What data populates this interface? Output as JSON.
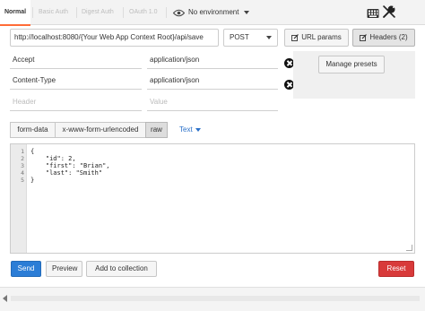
{
  "tabs": [
    {
      "label": "Normal",
      "active": true
    },
    {
      "label": "Basic Auth",
      "active": false
    },
    {
      "label": "Digest Auth",
      "active": false
    },
    {
      "label": "OAuth 1.0",
      "active": false
    }
  ],
  "environment": {
    "label": "No environment",
    "icon": "eye-icon"
  },
  "toolbar_icons": [
    "keyboard-icon",
    "wrench-icon"
  ],
  "request": {
    "url": "http://localhost:8080/{Your Web App Context Root}/api/save",
    "method": "POST",
    "url_params_label": "URL params",
    "headers_label": "Headers (2)"
  },
  "headers": [
    {
      "key": "Accept",
      "value": "application/json"
    },
    {
      "key": "Content-Type",
      "value": "application/json"
    }
  ],
  "header_placeholders": {
    "key": "Header",
    "value": "Value"
  },
  "manage_presets_label": "Manage presets",
  "body_modes": [
    {
      "label": "form-data",
      "active": false
    },
    {
      "label": "x-www-form-urlencoded",
      "active": false
    },
    {
      "label": "raw",
      "active": true
    }
  ],
  "raw_format": "Text",
  "editor": {
    "line_numbers": [
      "1",
      "2",
      "3",
      "4",
      "5"
    ],
    "lines": [
      "{",
      "    \"id\": 2,",
      "    \"first\": \"Brian\",",
      "    \"last\": \"Smith\"",
      "}"
    ]
  },
  "actions": {
    "send": "Send",
    "preview": "Preview",
    "add_to_collection": "Add to collection",
    "reset": "Reset"
  },
  "colors": {
    "send": "#2b7dd6",
    "reset": "#d83a3a",
    "link": "#2a70c9",
    "active_tab_underline": "#ff6c37"
  }
}
